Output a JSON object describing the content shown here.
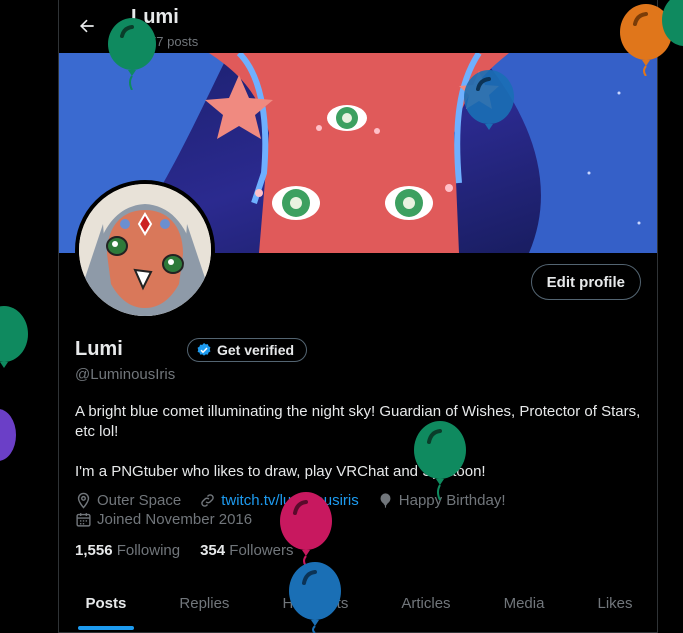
{
  "header": {
    "title": "Lumi",
    "post_count": "1,977 posts"
  },
  "profile": {
    "display_name": "Lumi",
    "handle": "@LuminousIris",
    "edit_button": "Edit profile",
    "verify_button": "Get verified",
    "bio_line1": "A bright blue comet illuminating the night sky! Guardian of Wishes, Protector of Stars, etc lol!",
    "bio_line2": "I'm a PNGtuber who likes to draw, play VRChat and Splatoon!",
    "location": "Outer Space",
    "website": "twitch.tv/luminousiris",
    "birthday": "Happy Birthday!",
    "joined": "Joined November 2016",
    "following_count": "1,556",
    "following_label": "Following",
    "followers_count": "354",
    "followers_label": "Followers"
  },
  "tabs": [
    {
      "label": "Posts",
      "active": true
    },
    {
      "label": "Replies"
    },
    {
      "label": "Highlights"
    },
    {
      "label": "Articles"
    },
    {
      "label": "Media"
    },
    {
      "label": "Likes"
    }
  ],
  "colors": {
    "accent": "#1d9bf0",
    "background": "#000000",
    "balloon_green": "#0f8a5f",
    "balloon_orange": "#e0761b",
    "balloon_blue": "#1a6fb5",
    "balloon_pink": "#c8185f",
    "balloon_purple": "#6b3fc7"
  },
  "icons": [
    "back-arrow-icon",
    "verified-badge-icon",
    "location-icon",
    "link-icon",
    "balloon-icon",
    "calendar-icon"
  ]
}
